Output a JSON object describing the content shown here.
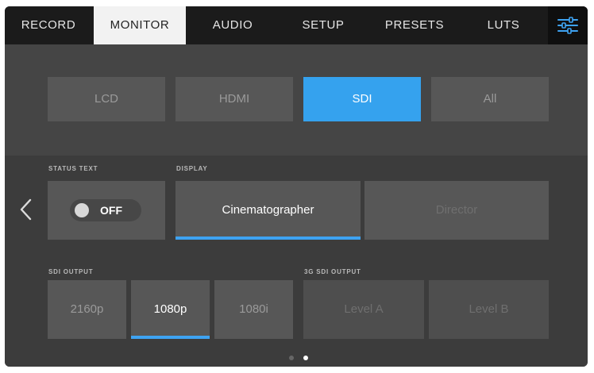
{
  "tabs": [
    {
      "label": "RECORD"
    },
    {
      "label": "MONITOR"
    },
    {
      "label": "AUDIO"
    },
    {
      "label": "SETUP"
    },
    {
      "label": "PRESETS"
    },
    {
      "label": "LUTS"
    }
  ],
  "active_tab": "MONITOR",
  "settings_icon": "sliders-icon",
  "monitor_targets": [
    {
      "label": "LCD"
    },
    {
      "label": "HDMI"
    },
    {
      "label": "SDI",
      "selected": true
    },
    {
      "label": "All"
    }
  ],
  "status_text": {
    "label": "STATUS TEXT",
    "value": "OFF"
  },
  "display": {
    "label": "DISPLAY",
    "options": [
      {
        "label": "Cinematographer",
        "selected": true
      },
      {
        "label": "Director"
      }
    ]
  },
  "sdi_output": {
    "label": "SDI OUTPUT",
    "options": [
      {
        "label": "2160p"
      },
      {
        "label": "1080p",
        "selected": true
      },
      {
        "label": "1080i"
      }
    ]
  },
  "threeg_sdi_output": {
    "label": "3G SDI OUTPUT",
    "options": [
      {
        "label": "Level A"
      },
      {
        "label": "Level B"
      }
    ]
  },
  "pagination": {
    "current": 2,
    "total": 2
  },
  "colors": {
    "accent": "#35a2ee",
    "panel": "#575757",
    "background": "#4a4a4a"
  }
}
